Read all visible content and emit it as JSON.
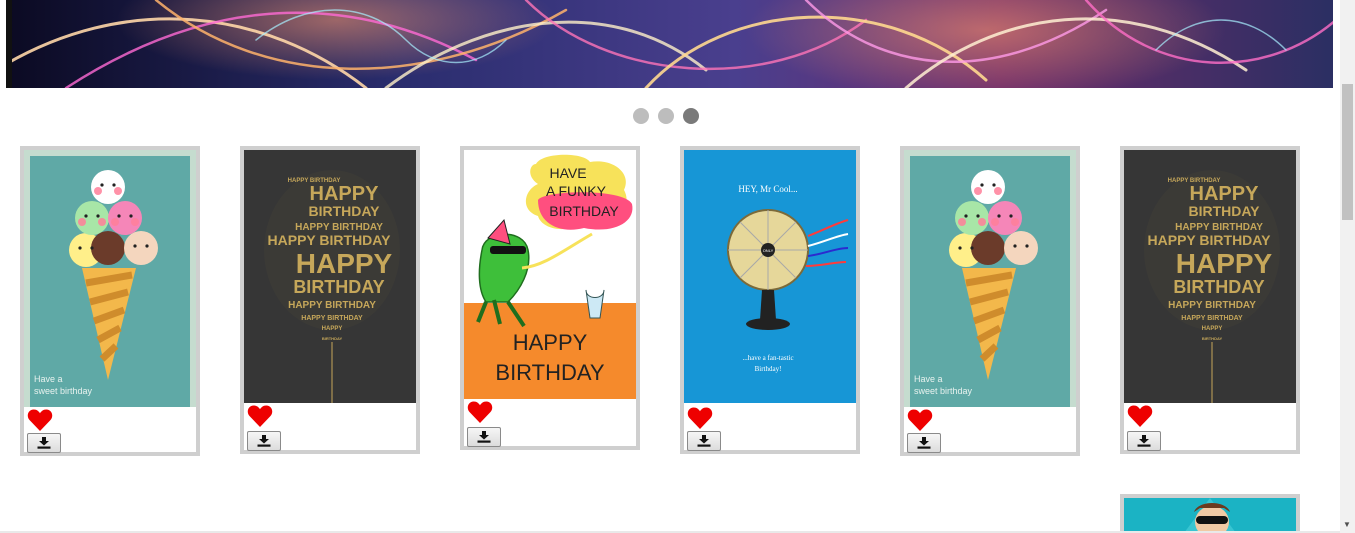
{
  "carousel": {
    "slides": 3,
    "active_index": 2
  },
  "colors": {
    "tile_border": "#cfcfcf",
    "heart": "#ee0000",
    "dot_inactive": "#bdbdbd",
    "dot_active": "#7a7a7a",
    "teal_card": "#5fa9a6",
    "dark_card": "#363636",
    "frog_orange": "#f58a2c",
    "fan_blue": "#1796d6"
  },
  "cards": [
    {
      "name": "ice-cream-card",
      "text": "Have a sweet birthday",
      "line1": "Have a",
      "line2": "sweet birthday"
    },
    {
      "name": "balloon-typography-card",
      "line_big": "HAPPY",
      "line_mid": "BIRTHDAY",
      "line_small": "HAPPY BIRTHDAY"
    },
    {
      "name": "funky-frog-card",
      "bubble_line1": "HAVE",
      "bubble_line2": "A FUNKY",
      "bubble_line3": "BIRTHDAY",
      "bottom_line1": "HAPPY",
      "bottom_line2": "BIRTHDAY"
    },
    {
      "name": "mr-cool-fan-card",
      "top_text": "HEY, Mr Cool...",
      "bottom_line1": "...have a fan-tastic",
      "bottom_line2": "Birthday!",
      "fan_label": "ONLY"
    },
    {
      "name": "ice-cream-card-2",
      "line1": "Have a",
      "line2": "sweet birthday"
    },
    {
      "name": "balloon-typography-card-2",
      "line_big": "HAPPY",
      "line_mid": "BIRTHDAY",
      "line_small": "HAPPY BIRTHDAY"
    }
  ],
  "icons": {
    "favorite": "heart-icon",
    "download": "download-icon"
  }
}
